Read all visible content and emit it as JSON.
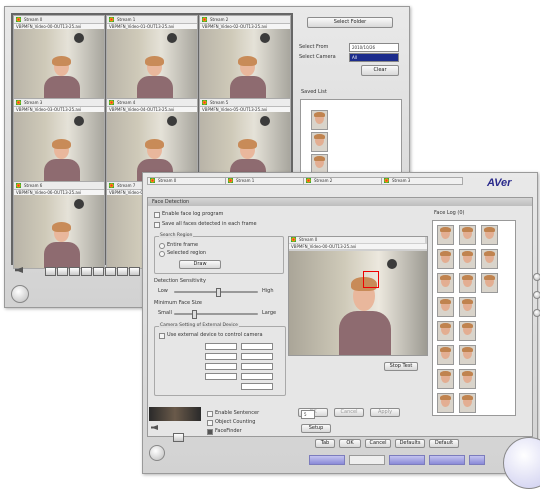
{
  "back_window": {
    "tiles": [
      {
        "title": "Stream 0",
        "sub": "VBPMFN_Video-00-OUT13-25.avi"
      },
      {
        "title": "Stream 1",
        "sub": "VBPMFN_Video-01-OUT13-25.avi"
      },
      {
        "title": "Stream 2",
        "sub": "VBPMFN_Video-02-OUT13-25.avi"
      },
      {
        "title": "Stream 3",
        "sub": "VBPMFN_Video-03-OUT13-25.avi"
      },
      {
        "title": "Stream 4",
        "sub": "VBPMFN_Video-04-OUT13-25.avi"
      },
      {
        "title": "Stream 5",
        "sub": "VBPMFN_Video-05-OUT13-25.avi"
      },
      {
        "title": "Stream 6",
        "sub": "VBPMFN_Video-06-OUT13-25.avi"
      },
      {
        "title": "Stream 7",
        "sub": "VBPMFN_Video-07-OUT13-25.avi"
      },
      {
        "title": "Stream 8",
        "sub": "VBPMFN_Video-08-OUT13-25.avi"
      }
    ],
    "select_folder_label": "Select Folder",
    "select_from_label": "Select From",
    "select_camera_label": "Select Camera",
    "from_value": "2010/10/26",
    "camera_value": "All",
    "clear_label": "Clear",
    "saved_list_label": "Saved List"
  },
  "front_window": {
    "tabs": [
      "Stream 0",
      "Stream 1",
      "Stream 2",
      "Stream 3"
    ],
    "brand": "AVer",
    "dialog_title": "Face Detection",
    "enable_face_log": "Enable face log program",
    "save_all_faces": "Save all faces detected in each frame",
    "search_region": "Search Region",
    "whole_frame": "Entire frame",
    "selected_region": "Selected region",
    "draw_btn": "Draw",
    "detection_sensitivity": "Detection Sensitivity",
    "low": "Low",
    "high": "High",
    "min_face_size": "Minimum Face Size",
    "small": "Small",
    "large": "Large",
    "control_panel_title": "Camera Setting of External Device",
    "use_external": "Use external device to control camera",
    "preview_title": "Stream 0",
    "preview_sub": "VBPMFN_Video-00-OUT13-25.avi",
    "stop_test": "Stop Test",
    "face_log_title": "Face Log (0)",
    "bottom_btns": [
      "OK",
      "Cancel",
      "Apply"
    ],
    "enable_sentencer": "Enable Sentencer",
    "object_counting": "Object Counting",
    "face_finder": "FaceFinder",
    "setup_label": "Setup",
    "dialog_buttons": [
      "Tab",
      "OK",
      "Cancel",
      "Defaults",
      "Default"
    ],
    "spinner_value": "5"
  }
}
